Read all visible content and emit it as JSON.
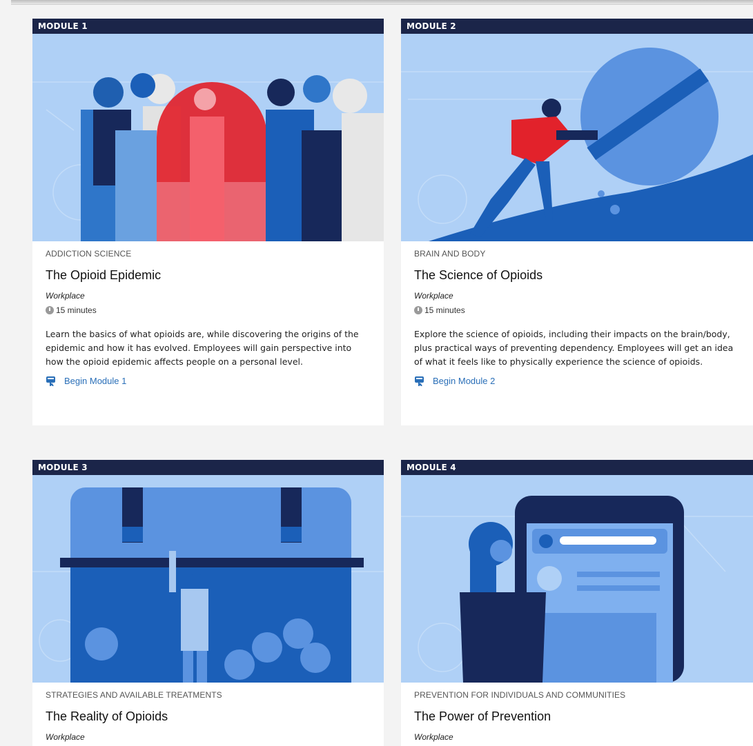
{
  "modules": [
    {
      "label": "MODULE 1",
      "category": "ADDICTION SCIENCE",
      "title": "The Opioid Epidemic",
      "audience": "Workplace",
      "duration": "15 minutes",
      "description": "Learn the basics of what opioids are, while discovering the origins of the epidemic and how it has evolved. Employees will gain perspective into how the opioid epidemic affects people on a personal level.",
      "cta": "Begin Module 1"
    },
    {
      "label": "MODULE 2",
      "category": "BRAIN AND BODY",
      "title": "The Science of Opioids",
      "audience": "Workplace",
      "duration": "15 minutes",
      "description": "Explore the science of opioids, including their impacts on the brain/body, plus practical ways of preventing dependency. Employees will get an idea of what it feels like to physically experience the science of opioids.",
      "cta": "Begin Module 2"
    },
    {
      "label": "MODULE 3",
      "category": "STRATEGIES AND AVAILABLE TREATMENTS",
      "title": "The Reality of Opioids",
      "audience": "Workplace"
    },
    {
      "label": "MODULE 4",
      "category": "PREVENTION FOR INDIVIDUALS AND COMMUNITIES",
      "title": "The Power of Prevention",
      "audience": "Workplace"
    }
  ],
  "colors": {
    "header_bar": "#1b2549",
    "illustration_bg": "#afd0f6",
    "link": "#2a6fb8"
  },
  "icons": {
    "duration": "clock-icon",
    "begin": "module-launch-icon"
  }
}
